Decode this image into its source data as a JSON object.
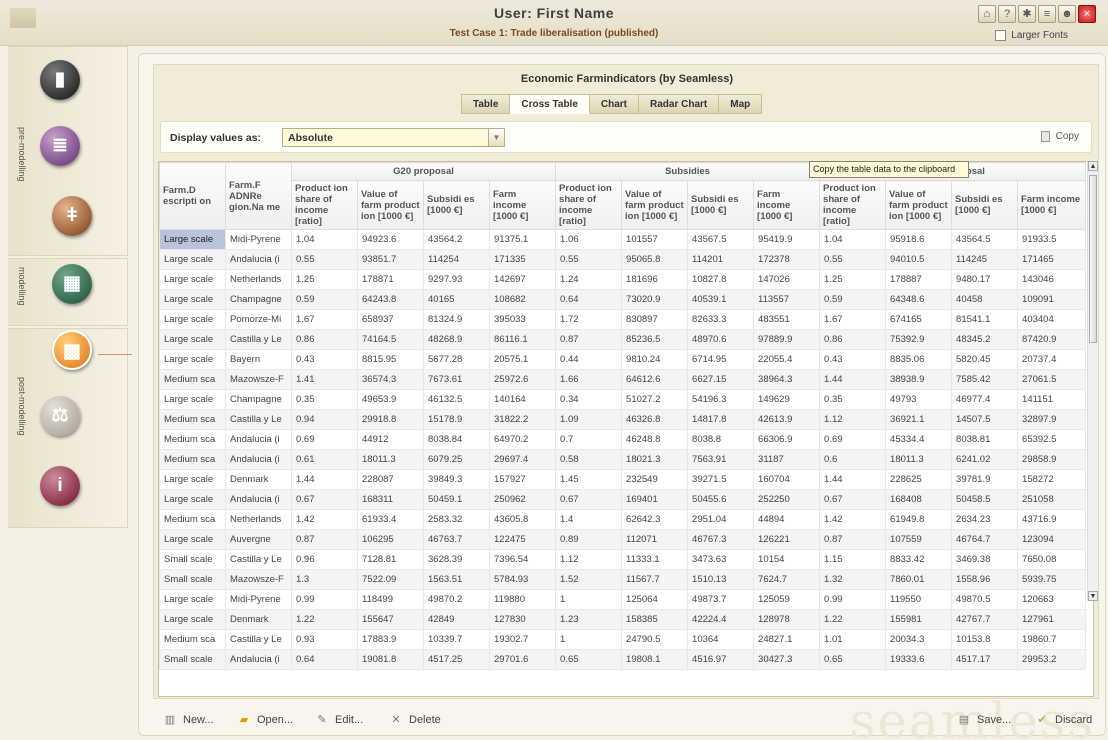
{
  "header": {
    "user_title": "User: First Name",
    "test_case": "Test Case 1: Trade liberalisation (published)",
    "larger_fonts": "Larger Fonts",
    "icons": [
      "home-icon",
      "help-icon",
      "settings-icon",
      "database-icon",
      "users-icon",
      "close-icon"
    ]
  },
  "sidebar": {
    "phases": [
      "pre-modelling",
      "modelling",
      "post-modelling"
    ],
    "items": [
      {
        "icon": "clipboard-icon"
      },
      {
        "icon": "books-icon"
      },
      {
        "icon": "thermometer-icon"
      },
      {
        "icon": "calculator-icon"
      },
      {
        "icon": "chart-icon",
        "active": true
      },
      {
        "icon": "scales-icon"
      },
      {
        "icon": "info-icon"
      }
    ]
  },
  "panel": {
    "title": "Economic Farmindicators (by Seamless)",
    "tabs": [
      "Table",
      "Cross Table",
      "Chart",
      "Radar Chart",
      "Map"
    ],
    "active_tab": "Cross Table",
    "display_label": "Display values as:",
    "display_value": "Absolute",
    "copy_label": "Copy",
    "tooltip": "Copy the table data to the clipboard"
  },
  "table": {
    "col_farm_desc": "Farm.D escripti on",
    "col_region": "Farm.F ADNRe gion.Na me",
    "groups": [
      "G20 proposal",
      "Subsidies",
      "WTO proposal"
    ],
    "indicators": [
      "Product ion share of income [ratio]",
      "Value of farm product ion [1000 €]",
      "Subsidi es [1000 €]",
      "Farm income [1000 €]"
    ],
    "rows": [
      [
        "Large scale",
        "Midi-Pyrene",
        "1.04",
        "94923.6",
        "43564.2",
        "91375.1",
        "1.06",
        "101557",
        "43567.5",
        "95419.9",
        "1.04",
        "95918.6",
        "43564.5",
        "91933.5"
      ],
      [
        "Large scale",
        "Andalucia (i",
        "0.55",
        "93851.7",
        "114254",
        "171335",
        "0.55",
        "95065.8",
        "114201",
        "172378",
        "0.55",
        "94010.5",
        "114245",
        "171465"
      ],
      [
        "Large scale",
        "Netherlands",
        "1.25",
        "178871",
        "9297.93",
        "142697",
        "1.24",
        "181696",
        "10827.8",
        "147026",
        "1.25",
        "178887",
        "9480.17",
        "143046"
      ],
      [
        "Large scale",
        "Champagne",
        "0.59",
        "64243.8",
        "40165",
        "108682",
        "0.64",
        "73020.9",
        "40539.1",
        "113557",
        "0.59",
        "64348.6",
        "40458",
        "109091"
      ],
      [
        "Large scale",
        "Pomorze-Mi",
        "1.67",
        "658937",
        "81324.9",
        "395033",
        "1.72",
        "830897",
        "82633.3",
        "483551",
        "1.67",
        "674165",
        "81541.1",
        "403404"
      ],
      [
        "Large scale",
        "Castilla y Le",
        "0.86",
        "74164.5",
        "48268.9",
        "86116.1",
        "0.87",
        "85236.5",
        "48970.6",
        "97889.9",
        "0.86",
        "75392.9",
        "48345.2",
        "87420.9"
      ],
      [
        "Large scale",
        "Bayern",
        "0.43",
        "8815.95",
        "5677.28",
        "20575.1",
        "0.44",
        "9810.24",
        "6714.95",
        "22055.4",
        "0.43",
        "8835.06",
        "5820.45",
        "20737.4"
      ],
      [
        "Medium sca",
        "Mazowsze-F",
        "1.41",
        "36574.3",
        "7673.61",
        "25972.6",
        "1.66",
        "64612.6",
        "6627.15",
        "38964.3",
        "1.44",
        "38938.9",
        "7585.42",
        "27061.5"
      ],
      [
        "Large scale",
        "Champagne",
        "0.35",
        "49653.9",
        "46132.5",
        "140164",
        "0.34",
        "51027.2",
        "54196.3",
        "149629",
        "0.35",
        "49793",
        "46977.4",
        "141151"
      ],
      [
        "Medium sca",
        "Castilla y Le",
        "0.94",
        "29918.8",
        "15178.9",
        "31822.2",
        "1.09",
        "46326.8",
        "14817.8",
        "42613.9",
        "1.12",
        "36921.1",
        "14507.5",
        "32897.9"
      ],
      [
        "Medium sca",
        "Andalucia (i",
        "0.69",
        "44912",
        "8038.84",
        "64970.2",
        "0.7",
        "46248.8",
        "8038.8",
        "66306.9",
        "0.69",
        "45334.4",
        "8038.81",
        "65392.5"
      ],
      [
        "Medium sca",
        "Andalucia (i",
        "0.61",
        "18011.3",
        "6079.25",
        "29697.4",
        "0.58",
        "18021.3",
        "7563.91",
        "31187",
        "0.6",
        "18011.3",
        "6241.02",
        "29858.9"
      ],
      [
        "Large scale",
        "Denmark",
        "1.44",
        "228087",
        "39849.3",
        "157927",
        "1.45",
        "232549",
        "39271.5",
        "160704",
        "1.44",
        "228625",
        "39781.9",
        "158272"
      ],
      [
        "Large scale",
        "Andalucia (i",
        "0.67",
        "168311",
        "50459.1",
        "250962",
        "0.67",
        "169401",
        "50455.6",
        "252250",
        "0.67",
        "168408",
        "50458.5",
        "251058"
      ],
      [
        "Medium sca",
        "Netherlands",
        "1.42",
        "61933.4",
        "2583.32",
        "43605.8",
        "1.4",
        "62642.3",
        "2951.04",
        "44894",
        "1.42",
        "61949.8",
        "2634.23",
        "43716.9"
      ],
      [
        "Large scale",
        "Auvergne",
        "0.87",
        "106295",
        "46763.7",
        "122475",
        "0.89",
        "112071",
        "46767.3",
        "126221",
        "0.87",
        "107559",
        "46764.7",
        "123094"
      ],
      [
        "Small scale",
        "Castilla y Le",
        "0.96",
        "7128.81",
        "3628.39",
        "7396.54",
        "1.12",
        "11333.1",
        "3473.63",
        "10154",
        "1.15",
        "8833.42",
        "3469.38",
        "7650.08"
      ],
      [
        "Small scale",
        "Mazowsze-F",
        "1.3",
        "7522.09",
        "1563.51",
        "5784.93",
        "1.52",
        "11567.7",
        "1510.13",
        "7624.7",
        "1.32",
        "7860.01",
        "1558.96",
        "5939.75"
      ],
      [
        "Large scale",
        "Midi-Pyrene",
        "0.99",
        "118499",
        "49870.2",
        "119880",
        "1",
        "125064",
        "49873.7",
        "125059",
        "0.99",
        "119550",
        "49870.5",
        "120663"
      ],
      [
        "Large scale",
        "Denmark",
        "1.22",
        "155647",
        "42849",
        "127830",
        "1.23",
        "158385",
        "42224.4",
        "128978",
        "1.22",
        "155981",
        "42767.7",
        "127961"
      ],
      [
        "Medium sca",
        "Castilla y Le",
        "0.93",
        "17883.9",
        "10339.7",
        "19302.7",
        "1",
        "24790.5",
        "10364",
        "24827.1",
        "1.01",
        "20034.3",
        "10153.8",
        "19860.7"
      ],
      [
        "Small scale",
        "Andalucia (i",
        "0.64",
        "19081.8",
        "4517.25",
        "29701.6",
        "0.65",
        "19808.1",
        "4516.97",
        "30427.3",
        "0.65",
        "19333.6",
        "4517.17",
        "29953.2"
      ]
    ]
  },
  "toolbar": {
    "new": "New...",
    "open": "Open...",
    "edit": "Edit...",
    "delete": "Delete",
    "save": "Save...",
    "discard": "Discard",
    "watermark": "seamless"
  }
}
